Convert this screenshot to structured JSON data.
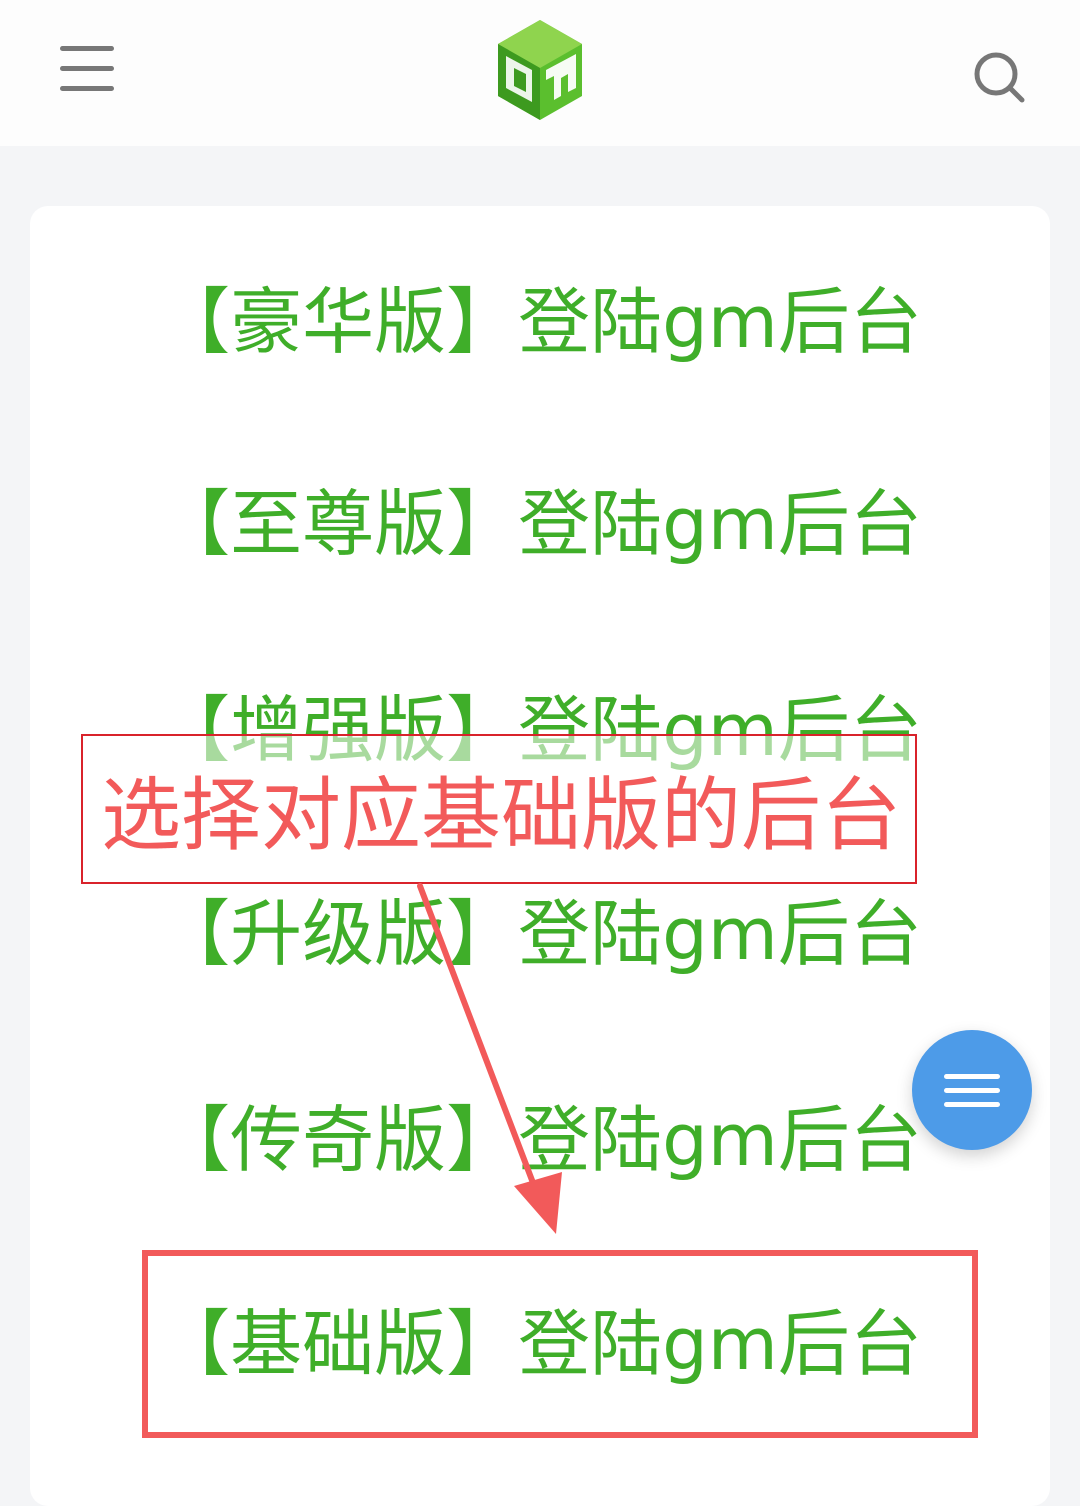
{
  "header": {
    "menu_icon": "hamburger-menu-icon",
    "logo_icon": "gm-logo-icon",
    "search_icon": "search-icon"
  },
  "links": [
    {
      "label": "【豪华版】登陆gm后台"
    },
    {
      "label": "【至尊版】登陆gm后台"
    },
    {
      "label": "【增强版】登陆gm后台"
    },
    {
      "label": "【升级版】登陆gm后台"
    },
    {
      "label": "【传奇版】登陆gm后台"
    },
    {
      "label": "【基础版】登陆gm后台"
    }
  ],
  "annotation": {
    "callout_text": "选择对应基础版的后台",
    "color": "#f25a5a"
  },
  "colors": {
    "link": "#3fae29",
    "fab": "#4d9be8"
  },
  "fab": {
    "icon": "menu-lines-icon"
  }
}
